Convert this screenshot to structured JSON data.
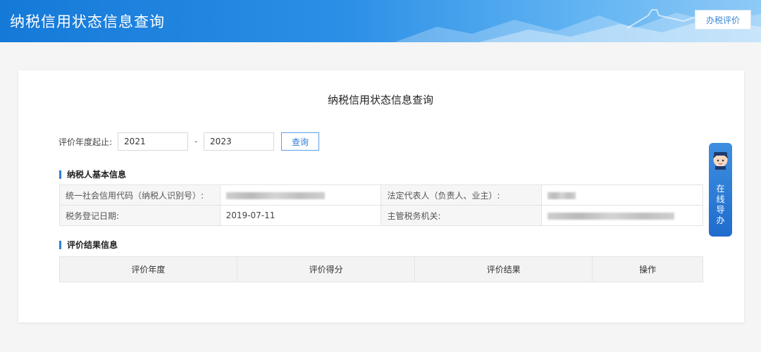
{
  "header": {
    "title": "纳税信用状态信息查询",
    "rate_button": "办税评价"
  },
  "card": {
    "title": "纳税信用状态信息查询"
  },
  "query": {
    "label": "评价年度起止:",
    "start_year": "2021",
    "separator": "-",
    "end_year": "2023",
    "button": "查询"
  },
  "taxpayer_section": {
    "heading": "纳税人基本信息",
    "credit_code_label": "统一社会信用代码（纳税人识别号）:",
    "legal_rep_label": "法定代表人（负责人、业主）:",
    "reg_date_label": "税务登记日期:",
    "reg_date_value": "2019-07-11",
    "tax_authority_label": "主管税务机关:"
  },
  "result_section": {
    "heading": "评价结果信息",
    "columns": [
      "评价年度",
      "评价得分",
      "评价结果",
      "操作"
    ]
  },
  "side_guide": {
    "chars": [
      "在",
      "线",
      "导",
      "办"
    ]
  },
  "colors": {
    "accent": "#2f7ed8",
    "banner_start": "#1579d8",
    "banner_end": "#8fcaf6"
  }
}
